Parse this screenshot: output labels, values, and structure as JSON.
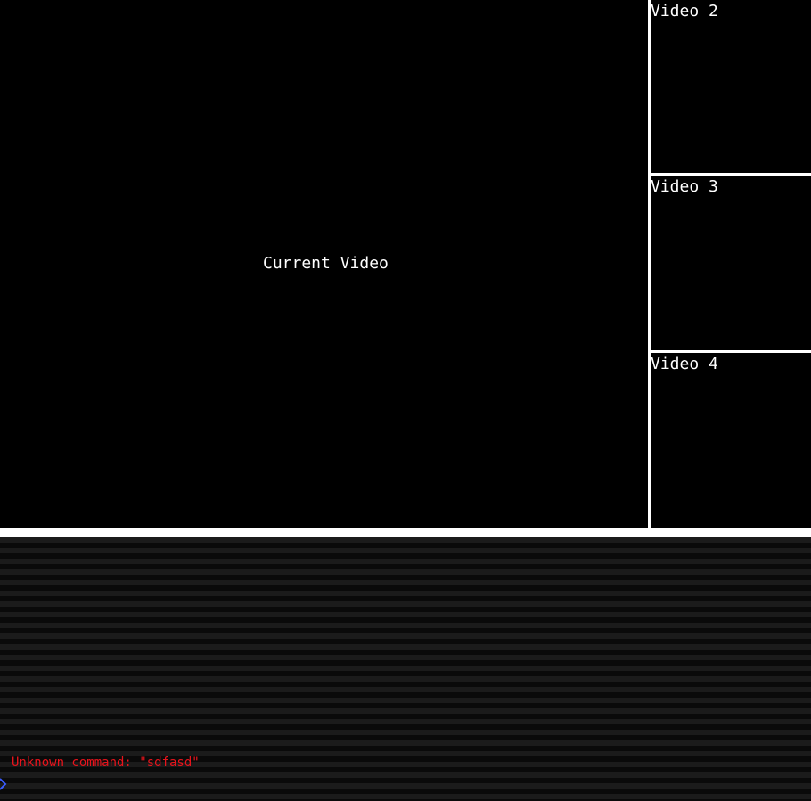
{
  "main_view": {
    "label": "Current Video"
  },
  "thumbnails": [
    {
      "label": "Video 2"
    },
    {
      "label": "Video 3"
    },
    {
      "label": "Video 4"
    }
  ],
  "console": {
    "error_message": "Unknown command: \"sdfasd\"",
    "input_value": "",
    "input_placeholder": "",
    "prompt_icon": "chevron-right-icon"
  },
  "colors": {
    "background": "#000000",
    "divider": "#ffffff",
    "error_text": "#e8141c",
    "prompt": "#3a5cff",
    "label_text": "#ffffff"
  }
}
